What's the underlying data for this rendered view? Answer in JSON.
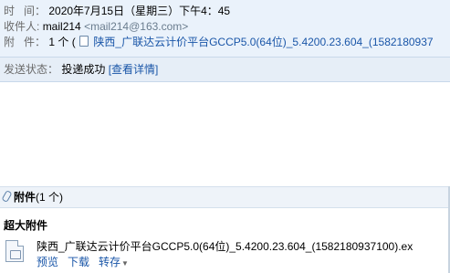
{
  "header": {
    "time_label": "时   间：",
    "time_value": "2020年7月15日（星期三）下午4：45",
    "recipient_label": "收件人:",
    "recipient_name": "mail214",
    "recipient_email": "<mail214@163.com>",
    "attachment_label": "附   件：",
    "attachment_count": "1 个 (",
    "attachment_name": "陕西_广联达云计价平台GCCP5.0(64位)_5.4200.23.604_(1582180937"
  },
  "status": {
    "label": "发送状态：",
    "value": "投递成功",
    "link": "[查看详情]"
  },
  "attachments": {
    "title": "附件",
    "count": "(1 个)",
    "section_title": "超大附件",
    "file_name": "陕西_广联达云计价平台GCCP5.0(64位)_5.4200.23.604_(1582180937100).ex",
    "actions": {
      "preview": "预览",
      "download": "下载",
      "forward": "转存"
    }
  },
  "icons": [
    "file-icon",
    "paperclip-icon",
    "chevron-down-icon"
  ],
  "colors": {
    "header_bg": "#eaf2fb",
    "link": "#1a56a8",
    "label": "#6a6a6a"
  }
}
